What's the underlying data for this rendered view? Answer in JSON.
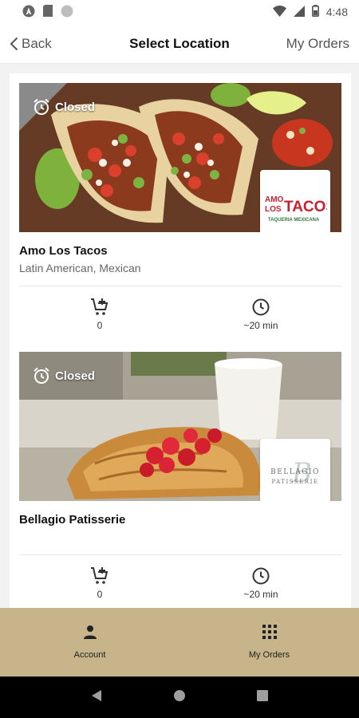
{
  "status_bar": {
    "time": "4:48"
  },
  "header": {
    "back_label": "Back",
    "title": "Select Location",
    "orders_label": "My Orders"
  },
  "locations": [
    {
      "status": "Closed",
      "name": "Amo Los Tacos",
      "cuisine": "Latin American, Mexican",
      "logo_line1": "AMO",
      "logo_line2": "LOS",
      "logo_big": "TACOS",
      "logo_sub": "TAQUERIA MEXICANA",
      "cart_count": "0",
      "wait_time": "~20 min"
    },
    {
      "status": "Closed",
      "name": "Bellagio Patisserie",
      "cuisine": "",
      "logo_line1": "BELLAGIO",
      "logo_line2": "PATISSERIE",
      "logo_script": "B",
      "cart_count": "0",
      "wait_time": "~20 min"
    }
  ],
  "bottom_nav": {
    "account_label": "Account",
    "orders_label": "My Orders"
  },
  "colors": {
    "accent": "#c7b48a",
    "taco_red": "#c8202e",
    "taco_green": "#2d7a3c"
  }
}
